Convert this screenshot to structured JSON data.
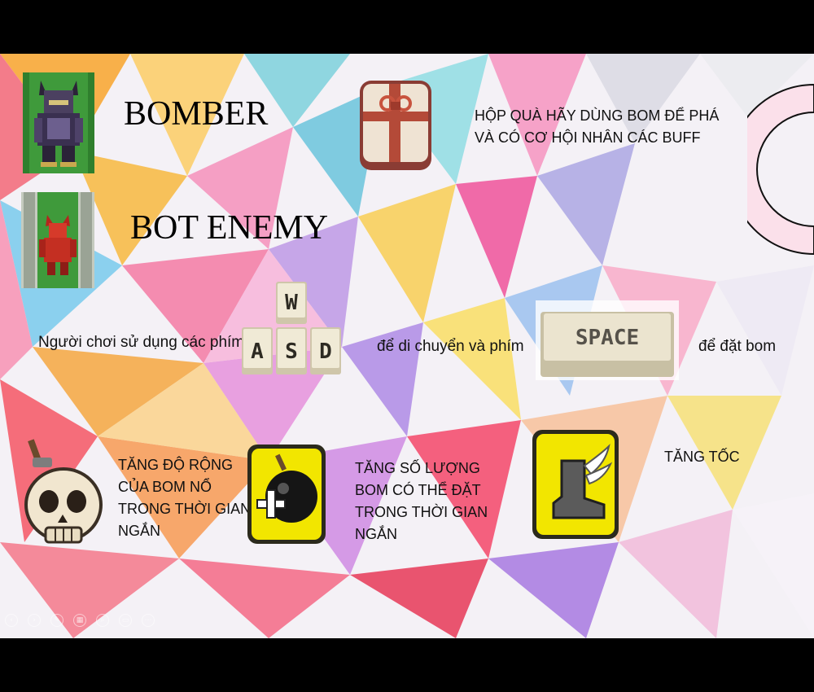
{
  "slide": {
    "bomber_label": "BOMBER",
    "bot_enemy_label": "BOT ENEMY",
    "gift_box_text_line1": "HỘP QUÀ HÃY DÙNG BOM ĐỂ PHÁ",
    "gift_box_text_line2": "VÀ CÓ CƠ HỘI NHÂN CÁC BUFF",
    "controls_text_1": "Người chơi sử dụng các phím",
    "controls_text_2": "để di chuyển và phím",
    "controls_text_3": "để đặt bom",
    "keys": {
      "w": "W",
      "a": "A",
      "s": "S",
      "d": "D",
      "space": "SPACE"
    },
    "buff_range_lines": [
      "TĂNG ĐỘ RỘNG",
      "CỦA BOM NỔ",
      "TRONG THỜI GIAN",
      "NGẮN"
    ],
    "buff_count_lines": [
      "TĂNG SỐ LƯỢNG",
      "BOM CÓ THỂ ĐẶT",
      "TRONG THỜI GIAN",
      "NGẮN"
    ],
    "buff_speed_label": "TĂNG TỐC"
  },
  "icons": [
    "bomber-sprite-icon",
    "bot-enemy-sprite-icon",
    "gift-box-icon",
    "wasd-keys-icon",
    "space-key-icon",
    "skull-bomb-icon",
    "bomb-plus-icon",
    "winged-boot-icon",
    "circle-decoration"
  ],
  "colors": {
    "frame": "#000000",
    "buff_tile": "#f2e600",
    "grass": "#3f9a3b",
    "ring_pink": "#fbe0ea"
  }
}
